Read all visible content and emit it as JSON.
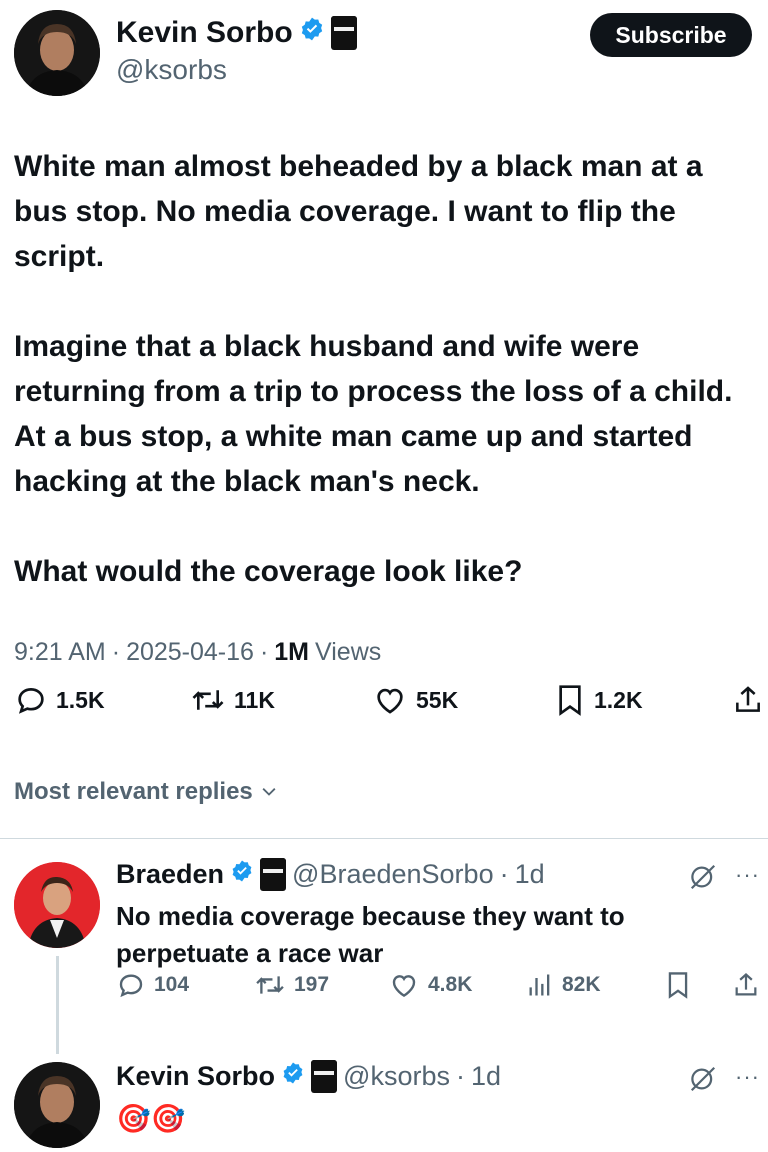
{
  "post": {
    "author_name": "Kevin Sorbo",
    "author_handle": "@ksorbs",
    "subscribe_label": "Subscribe",
    "paragraphs": [
      "White man almost beheaded by a black man at a bus stop.  No media coverage.  I want to flip the script.",
      "Imagine that a black husband and wife were returning from a trip to process the loss of a child. At a bus stop, a white man came up and started hacking at the black man's neck.",
      "What would the coverage look like?"
    ],
    "time": "9:21 AM",
    "date": "2025-04-16",
    "views_count": "1M",
    "views_label": "Views",
    "separator": "·",
    "stats": {
      "replies": "1.5K",
      "reposts": "11K",
      "likes": "55K",
      "bookmarks": "1.2K"
    }
  },
  "replies_sort_label": "Most relevant replies",
  "replies": [
    {
      "author_name": "Braeden",
      "author_handle": "@BraedenSorbo",
      "age": "1d",
      "text": "No media coverage because they want to perpetuate a race war",
      "stats": {
        "replies": "104",
        "reposts": "197",
        "likes": "4.8K",
        "views": "82K"
      }
    },
    {
      "author_name": "Kevin Sorbo",
      "author_handle": "@ksorbs",
      "age": "1d",
      "text": "🎯🎯"
    }
  ],
  "icons": {
    "verified": "verified-badge-icon",
    "affiliate": "affiliate-badge-icon",
    "reply": "reply-icon",
    "repost": "repost-icon",
    "like": "heart-icon",
    "bookmark": "bookmark-icon",
    "share": "share-icon",
    "views": "views-icon",
    "grok": "grok-icon",
    "more": "more-icon",
    "chevron": "chevron-down-icon"
  },
  "colors": {
    "text_primary": "#0f1419",
    "text_secondary": "#536471",
    "verified_blue": "#1d9bf0",
    "button_bg": "#0f1419",
    "divider": "#cfd9de"
  }
}
